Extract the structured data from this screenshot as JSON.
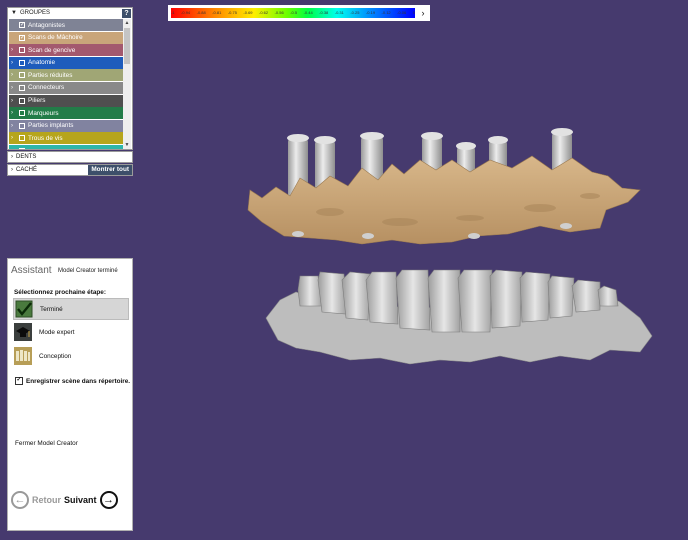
{
  "groups": {
    "header": "GROUPES",
    "help": "?",
    "items": [
      {
        "label": "Antagonistes",
        "color": "#7f8395",
        "checked": true,
        "expandable": false
      },
      {
        "label": "Scans de Mâchoire",
        "color": "#c9a57a",
        "checked": true,
        "expandable": false
      },
      {
        "label": "Scan de gencive",
        "color": "#a3596e",
        "checked": false,
        "expandable": true
      },
      {
        "label": "Anatomie",
        "color": "#1e5cbc",
        "checked": false,
        "expandable": true
      },
      {
        "label": "Parties réduites",
        "color": "#a0a675",
        "checked": false,
        "expandable": true
      },
      {
        "label": "Connecteurs",
        "color": "#898989",
        "checked": false,
        "expandable": true
      },
      {
        "label": "Piliers",
        "color": "#4f4f4f",
        "checked": false,
        "expandable": true
      },
      {
        "label": "Marqueurs",
        "color": "#227c48",
        "checked": false,
        "expandable": true
      },
      {
        "label": "Parties implants",
        "color": "#8183a0",
        "checked": false,
        "expandable": true
      },
      {
        "label": "Trous de vis",
        "color": "#b6a51c",
        "checked": false,
        "expandable": true
      },
      {
        "label": "",
        "color": "#2db6aa",
        "checked": false,
        "expandable": true
      }
    ]
  },
  "dents": {
    "label": "DENTS"
  },
  "cache": {
    "label": "CACHÉ",
    "button": "Montrer tout"
  },
  "scale": {
    "ticks": [
      "-1",
      "-0.94",
      "-0.88",
      "-0.81",
      "-0.75",
      "-0.69",
      "-0.62",
      "-0.56",
      "-0.5",
      "-0.44",
      "-0.38",
      "-0.31",
      "-0.25",
      "-0.19",
      "-0.12",
      "-0.06",
      "0"
    ],
    "arrow": "›"
  },
  "assistant": {
    "title": "Assistant",
    "subtitle": "Model Creator terminé",
    "prompt": "Sélectionnez prochaine étape:",
    "options": [
      {
        "label": "Terminé",
        "icon": "checkmark-icon",
        "selected": true
      },
      {
        "label": "Mode expert",
        "icon": "graduation-cap-icon",
        "selected": false
      },
      {
        "label": "Conception",
        "icon": "teeth-design-icon",
        "selected": false
      }
    ],
    "save_label": "Enregistrer scène dans répertoire.",
    "close_label": "Fermer Model Creator",
    "back_label": "Retour",
    "next_label": "Suivant"
  },
  "colors": {
    "background": "#463a6e",
    "gum": "#c9a57a",
    "teeth": "#c8c8c8",
    "implant": "#cfcfcf"
  }
}
